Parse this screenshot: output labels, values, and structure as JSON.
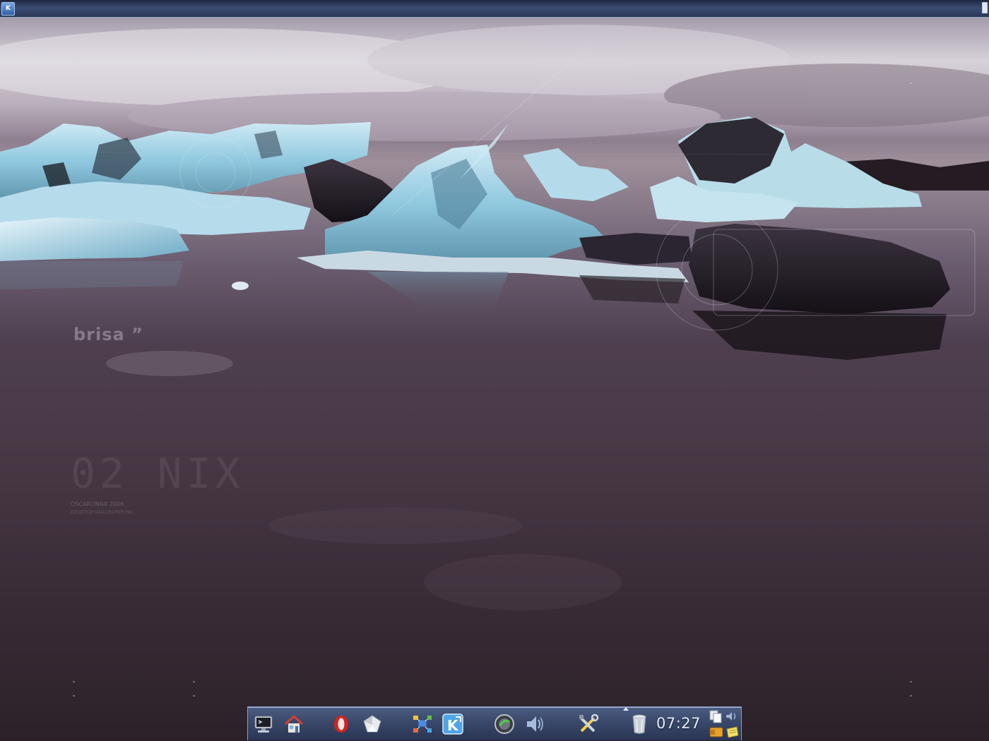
{
  "top_panel": {
    "kmenu_label": "K"
  },
  "wallpaper": {
    "watermark_tag": "brisa ”",
    "watermark_number": "02 NIX",
    "credit_line1": "OSCARLINNA 2006",
    "credit_line2": "DESKTOP-WALLPAPER.NU"
  },
  "dock": {
    "launchers": [
      {
        "name": "desktop",
        "icon": "monitor-icon"
      },
      {
        "name": "home",
        "icon": "home-icon"
      },
      {
        "name": "opera",
        "icon": "opera-icon"
      },
      {
        "name": "amarok-cube",
        "icon": "cube-icon"
      },
      {
        "name": "network",
        "icon": "network-icon"
      },
      {
        "name": "konqueror",
        "icon": "konqueror-icon"
      },
      {
        "name": "kopete",
        "icon": "chat-globe-icon"
      },
      {
        "name": "volume",
        "icon": "speaker-icon"
      },
      {
        "name": "settings",
        "icon": "tools-icon"
      },
      {
        "name": "trash",
        "icon": "trash-icon"
      }
    ],
    "clock": "07:27",
    "tray": [
      "copy-icon",
      "volume-small-icon",
      "wallet-icon",
      "notes-icon"
    ]
  },
  "colors": {
    "panel": "#3b4c72",
    "ice": "#a9d6ea",
    "water": "#4a3a47"
  }
}
